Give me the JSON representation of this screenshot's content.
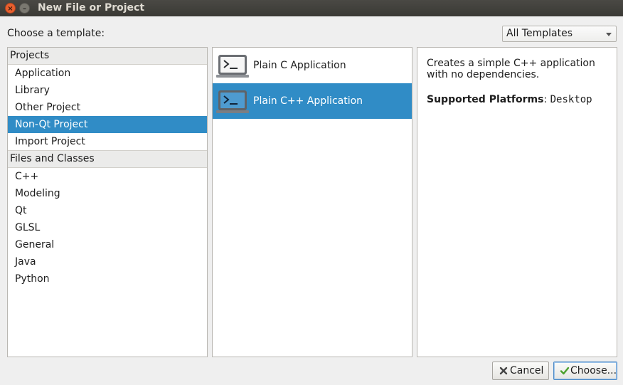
{
  "window": {
    "title": "New File or Project",
    "close_glyph": "×",
    "minimize_glyph": "–"
  },
  "header": {
    "choose_label": "Choose a template:",
    "filter_value": "All Templates"
  },
  "categories": {
    "groups": [
      {
        "label": "Projects",
        "items": [
          "Application",
          "Library",
          "Other Project",
          "Non-Qt Project",
          "Import Project"
        ]
      },
      {
        "label": "Files and Classes",
        "items": [
          "C++",
          "Modeling",
          "Qt",
          "GLSL",
          "General",
          "Java",
          "Python"
        ]
      }
    ],
    "selected": "Non-Qt Project"
  },
  "templates": {
    "items": [
      {
        "label": "Plain C Application",
        "icon": "terminal-icon"
      },
      {
        "label": "Plain C++ Application",
        "icon": "terminal-icon"
      }
    ],
    "selected": "Plain C++ Application"
  },
  "description": {
    "text": "Creates a simple C++ application with no dependencies.",
    "platforms_label": "Supported Platforms",
    "platforms_separator": ": ",
    "platforms_value": "Desktop"
  },
  "buttons": {
    "cancel_label": "Cancel",
    "choose_label": "Choose..."
  },
  "colors": {
    "selection": "#308cc6",
    "titlebar": "#3c3b37",
    "close_button": "#e9602e"
  }
}
